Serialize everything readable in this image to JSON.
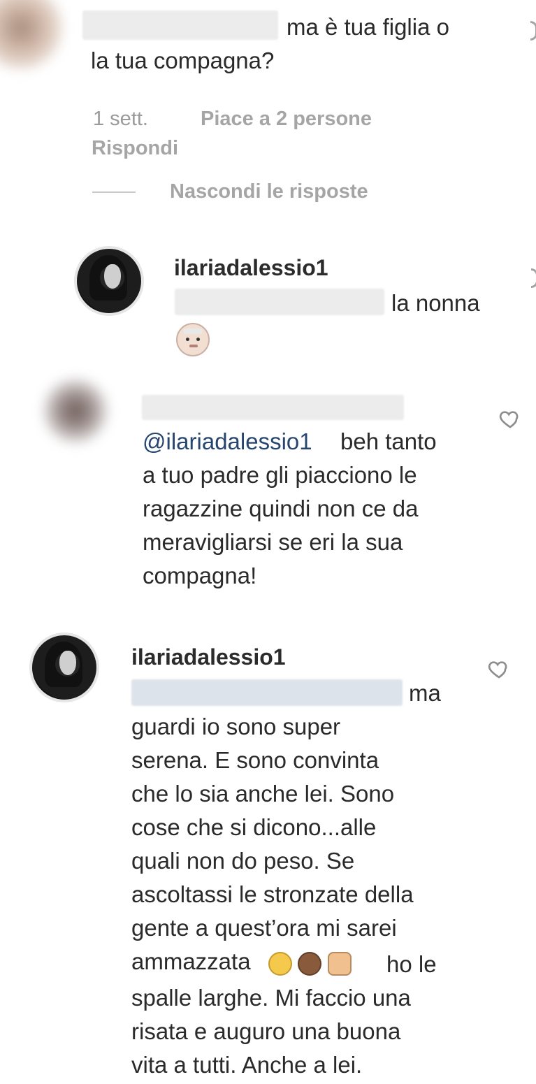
{
  "comment1": {
    "text": "ma è tua figlia o\nla tua compagna?",
    "time": "1 sett.",
    "likes": "Piace a 2 persone",
    "reply": "Rispondi",
    "hide_replies": "Nascondi le risposte"
  },
  "reply1": {
    "username": "ilariadalessio1",
    "text": "la nonna",
    "emoji": "older-woman-emoji"
  },
  "reply2": {
    "mention": "@ilariadalessio1",
    "text": "beh tanto\na tuo padre gli piacciono le\nragazzine quindi non ce da\nmeravigliarsi se eri la sua\ncompagna!"
  },
  "reply3": {
    "username": "ilariadalessio1",
    "text_start": "ma",
    "text_middle": "guardi io sono super\nserena. E sono convinta\nche lo sia anche lei. Sono\ncose che si dicono...alle\nquali non do peso. Se\nascoltassi le stronzate della\ngente a quest’ora mi sarei\nammazzata",
    "text_after_emojis": "ho le",
    "text_end": "spalle larghe. Mi faccio una\nrisata e auguro una buona\nvita a tutti. Anche a lei."
  },
  "icons": {
    "heart": "heart-icon",
    "laugh": "face-with-tears-of-joy-emoji",
    "monkey": "see-no-evil-monkey-emoji",
    "hands": "raising-hands-emoji"
  },
  "colors": {
    "text": "#262626",
    "muted": "#9a9a9a",
    "mention": "#27466f"
  }
}
